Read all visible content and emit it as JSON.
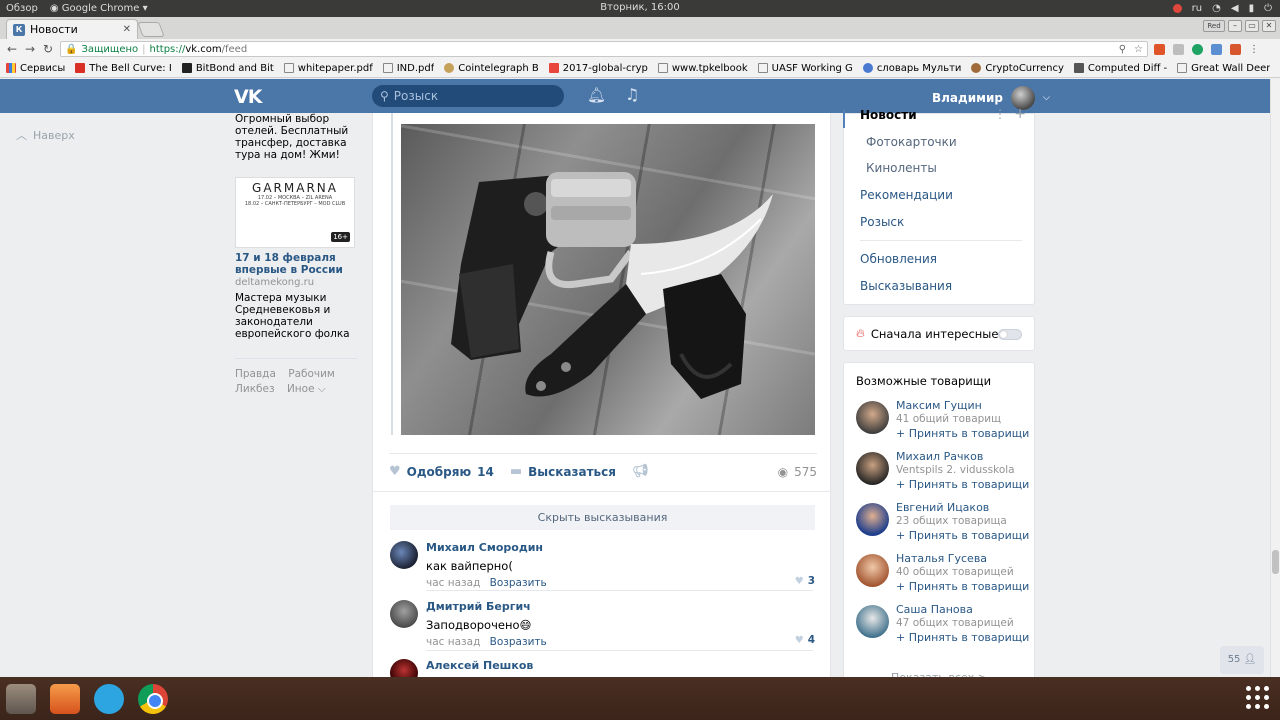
{
  "os": {
    "overview": "Обзор",
    "active_app": "Google Chrome",
    "clock": "Вторник, 16:00",
    "lang": "ru"
  },
  "browser": {
    "tab_title": "Новости",
    "tab_favicon": "К",
    "secure_label": "Защищено",
    "url_scheme": "https://",
    "url_host": "vk.com",
    "url_path": "/feed",
    "window_badge": "Red",
    "bookmarks": [
      "Сервисы",
      "The Bell Curve: I",
      "BitBond and Bit",
      "whitepaper.pdf",
      "IND.pdf",
      "Cointelegraph B",
      "2017-global-cryp",
      "www.tpkelbook",
      "UASF Working G",
      "словарь Мульти",
      "CryptoCurrency",
      "Computed Diff -",
      "Great Wall Deer"
    ]
  },
  "vk": {
    "logo": "VK",
    "search_placeholder": "Розыск",
    "user_name": "Владимир",
    "back_to_top": "Наверх"
  },
  "ad": {
    "top_text": "Огромный выбор отелей. Бесплатный трансфер, доставка тура на дом! Жми!",
    "banner_title": "GARMARNA",
    "banner_sub1": "17.02 – МОСКВА – ZIL ARENA",
    "banner_sub2": "18.02 – САНКТ-ПЕТЕРБУРГ – MOD CLUB",
    "banner_age": "16+",
    "link_title": "17 и 18 февраля впервые в России",
    "domain": "deltamekong.ru",
    "desc": "Мастера музыки Средневековья и законодатели европейского фолка",
    "footer": [
      "Правда",
      "Рабочим",
      "Ликбез",
      "Иное ⌵"
    ]
  },
  "post": {
    "like_label": "Одобряю",
    "like_count": "14",
    "comment_label": "Высказаться",
    "views": "575",
    "hide_comments": "Скрыть высказывания",
    "comments": [
      {
        "name": "Михаил Смородин",
        "text": "как вайперно(",
        "time": "час назад",
        "reply": "Возразить",
        "likes": "3"
      },
      {
        "name": "Дмитрий Бергич",
        "text": "Заподворочено😄",
        "time": "час назад",
        "reply": "Возразить",
        "likes": "4"
      },
      {
        "name": "Алексей Пешков",
        "text": "",
        "time": "",
        "reply": "",
        "likes": ""
      }
    ]
  },
  "menu": {
    "active": "Новости",
    "items": [
      "Фотокарточки",
      "Киноленты",
      "Рекомендации",
      "Розыск",
      "Обновления",
      "Высказывания"
    ]
  },
  "interest": {
    "label": "Сначала интересные"
  },
  "friends": {
    "header": "Возможные товарищи",
    "add_label": "+ Принять в товарищи",
    "items": [
      {
        "name": "Максим Гущин",
        "sub": "41 общий товарищ"
      },
      {
        "name": "Михаил Рачков",
        "sub": "Ventspils 2. vidusskola"
      },
      {
        "name": "Евгений Ицаков",
        "sub": "23 общих товарища"
      },
      {
        "name": "Наталья Гусева",
        "sub": "40 общих товарищей"
      },
      {
        "name": "Саша Панова",
        "sub": "47 общих товарищей"
      }
    ],
    "show_all": "Показать всех >"
  },
  "online_count": "55"
}
